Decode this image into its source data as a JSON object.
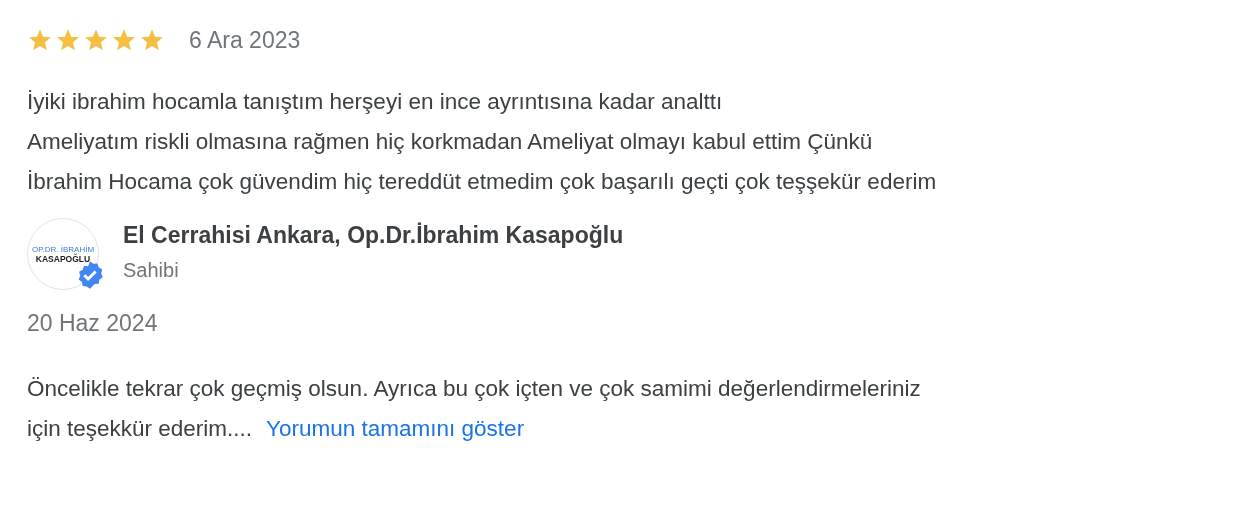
{
  "review": {
    "stars": 5,
    "date": "6 Ara 2023",
    "lines": [
      "İyiki ibrahim hocamla tanıştım herşeyi en ince ayrıntısına kadar analttı",
      "Ameliyatım riskli olmasına rağmen hiç korkmadan Ameliyat olmayı kabul ettim Çünkü",
      "İbrahim Hocama çok güvendim hiç tereddüt etmedim çok başarılı geçti çok teşşekür ederim"
    ]
  },
  "owner_reply": {
    "logo_top": "OP.DR. İBRAHİM",
    "logo_bottom": "KASAPOĞLU",
    "verified": true,
    "name": "El Cerrahisi Ankara, Op.Dr.İbrahim Kasapoğlu",
    "role": "Sahibi",
    "date": "20 Haz 2024",
    "lines": [
      "Öncelikle tekrar çok geçmiş olsun. Ayrıca bu çok içten ve çok samimi değerlendirmeleriniz",
      "için teşekkür ederim...."
    ],
    "more_link": "Yorumun tamamını göster"
  }
}
